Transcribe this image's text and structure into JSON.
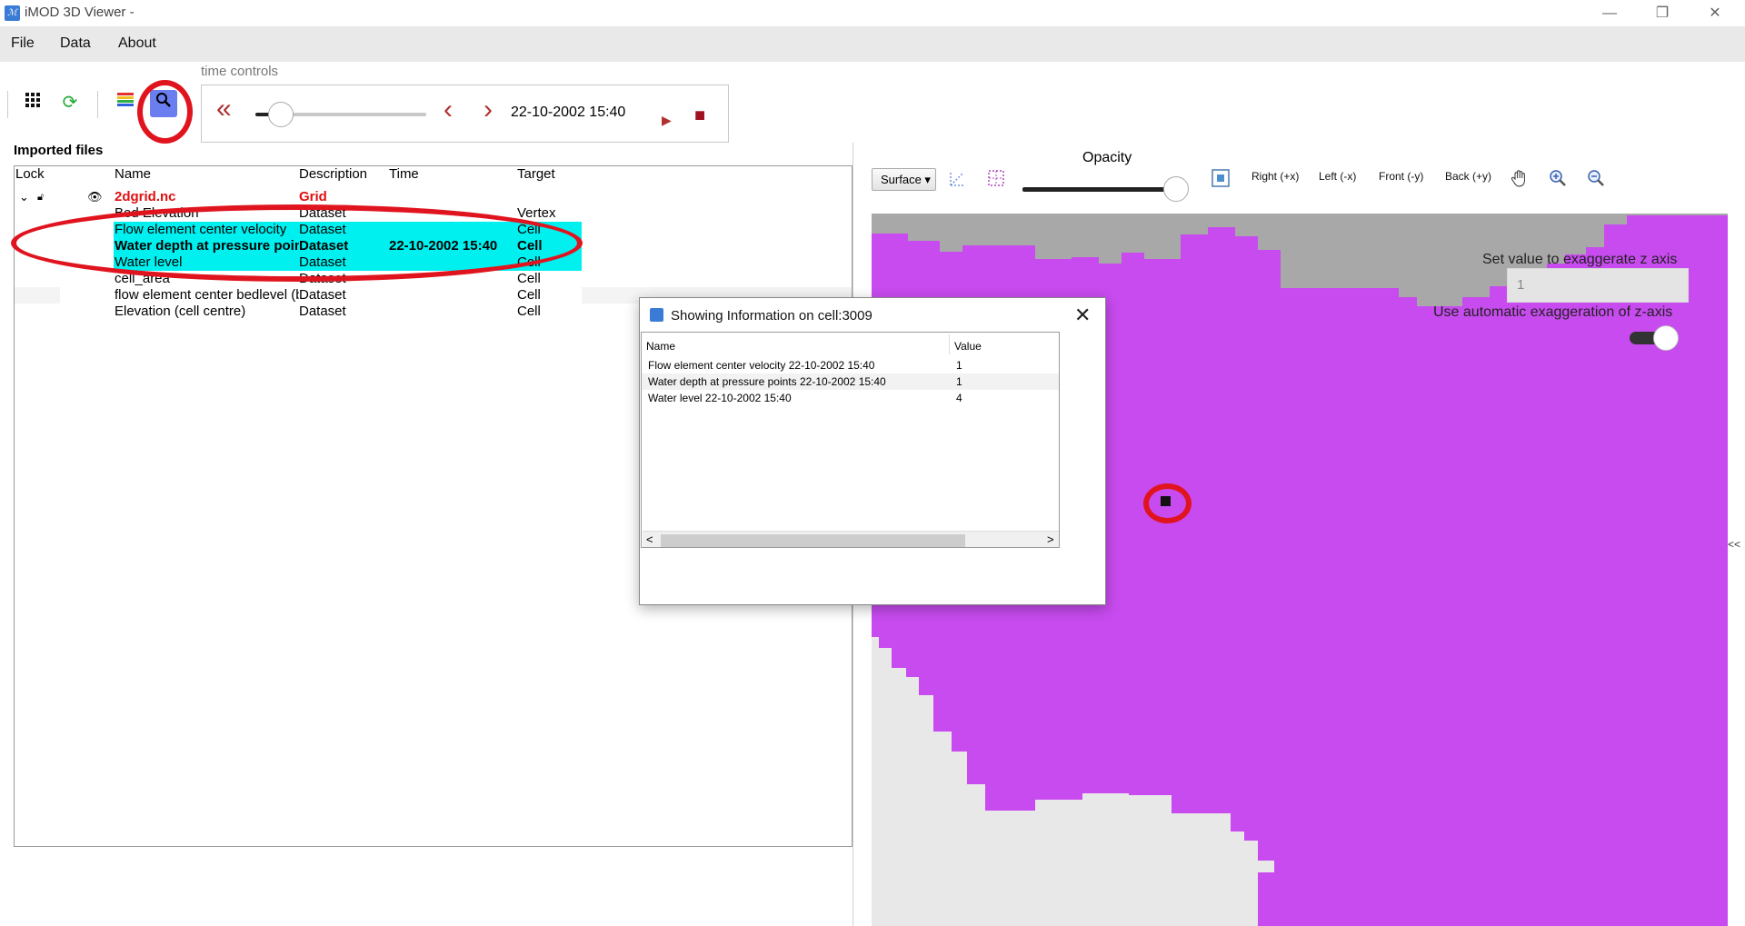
{
  "window": {
    "title": "iMOD 3D Viewer  -",
    "minimize": "—",
    "restore": "❐",
    "close": "✕"
  },
  "menu": [
    "File",
    "Data",
    "About"
  ],
  "toolbar": {
    "grid_icon": "grid-icon",
    "refresh_icon": "refresh-icon",
    "legend_icon": "legend-icon",
    "inspect_icon": "inspect-icon"
  },
  "time_controls": {
    "label": "time controls",
    "current_time": "22-10-2002 15:40",
    "slider_position": 0.1,
    "first_glyph": "«",
    "prev_glyph": "‹",
    "next_glyph": "›",
    "play_glyph": "▶",
    "stop_glyph": "■"
  },
  "imported_files": {
    "label": "Imported files",
    "columns": [
      "Lock",
      "Name",
      "Description",
      "Time",
      "Target"
    ],
    "root": {
      "name": "2dgrid.nc",
      "description": "Grid"
    },
    "rows": [
      {
        "name": "Bed Elevation",
        "description": "Dataset",
        "time": "",
        "target": "Vertex",
        "selected": false,
        "bold": false
      },
      {
        "name": "Flow element center velocity",
        "description": "Dataset",
        "time": "",
        "target": "Cell",
        "selected": true,
        "bold": false
      },
      {
        "name": "Water depth at pressure points",
        "description": "Dataset",
        "time": "22-10-2002 15:40",
        "target": "Cell",
        "selected": true,
        "bold": true
      },
      {
        "name": "Water level",
        "description": "Dataset",
        "time": "",
        "target": "Cell",
        "selected": true,
        "bold": false
      },
      {
        "name": "cell_area",
        "description": "Dataset",
        "time": "",
        "target": "Cell",
        "selected": false,
        "bold": false
      },
      {
        "name": "flow element center bedlevel (bl)",
        "description": "Dataset",
        "time": "",
        "target": "Cell",
        "selected": false,
        "bold": false
      },
      {
        "name": "Elevation (cell centre)",
        "description": "Dataset",
        "time": "",
        "target": "Cell",
        "selected": false,
        "bold": false
      }
    ]
  },
  "view_controls": {
    "surface_label": "Surface",
    "opacity_label": "Opacity",
    "opacity_value": 0.9,
    "right": "Right (+x)",
    "left": "Left (-x)",
    "front": "Front (-y)",
    "back": "Back (+y)",
    "set_z_label": "Set value to exaggerate z axis",
    "z_value": "1",
    "auto_z_label": "Use automatic exaggeration of z-axis",
    "collapse": "<<"
  },
  "info_dialog": {
    "title": "Showing Information on cell:3009",
    "close": "✕",
    "columns": [
      "Name",
      "Value"
    ],
    "rows": [
      {
        "name": "Flow element center velocity 22-10-2002 15:40",
        "value": "1"
      },
      {
        "name": "Water depth at pressure points 22-10-2002 15:40",
        "value": "1"
      },
      {
        "name": "Water level 22-10-2002 15:40",
        "value": "4"
      }
    ],
    "scroll_left": "<",
    "scroll_right": ">"
  },
  "colors": {
    "surface": "#c84bef",
    "terrain_dark": "#a8a8a8",
    "terrain_light": "#e8e8e8",
    "selection": "#00f0f0",
    "annotation": "#e0141e",
    "accent_red": "#b03030"
  }
}
